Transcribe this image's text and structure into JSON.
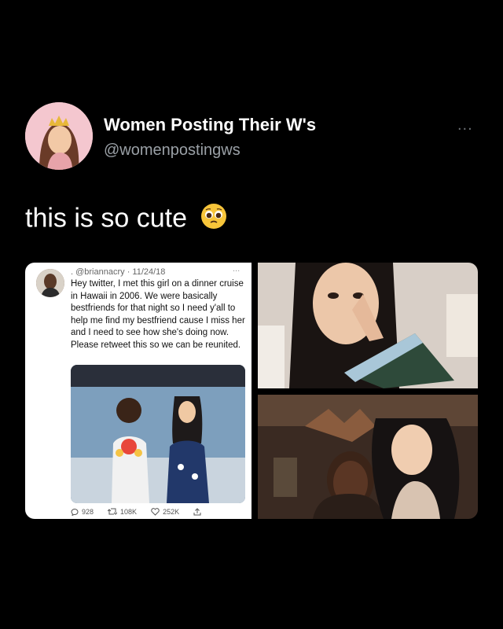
{
  "account": {
    "display_name": "Women Posting Their W's",
    "handle": "@womenpostingws",
    "more_label": "..."
  },
  "tweet": {
    "text": "this is so cute",
    "emoji": "pleading-face"
  },
  "embedded_tweet": {
    "meta": ". @briannacry · 11/24/18",
    "more_label": "...",
    "text": "Hey twitter, I met this girl on a dinner cruise in Hawaii in 2006. We were basically bestfriends for that night so I need y'all to help me find my bestfriend cause I miss her and I need to see how she's doing now. Please retweet this so we can be reunited.",
    "replies": "928",
    "retweets": "108K",
    "likes": "252K"
  },
  "icons": {
    "reply": "reply-icon",
    "retweet": "retweet-icon",
    "like": "heart-icon",
    "share": "share-icon"
  },
  "colors": {
    "background": "#000000",
    "handle": "#9aa0a6",
    "avatar_bg": "#f3c9cf"
  }
}
